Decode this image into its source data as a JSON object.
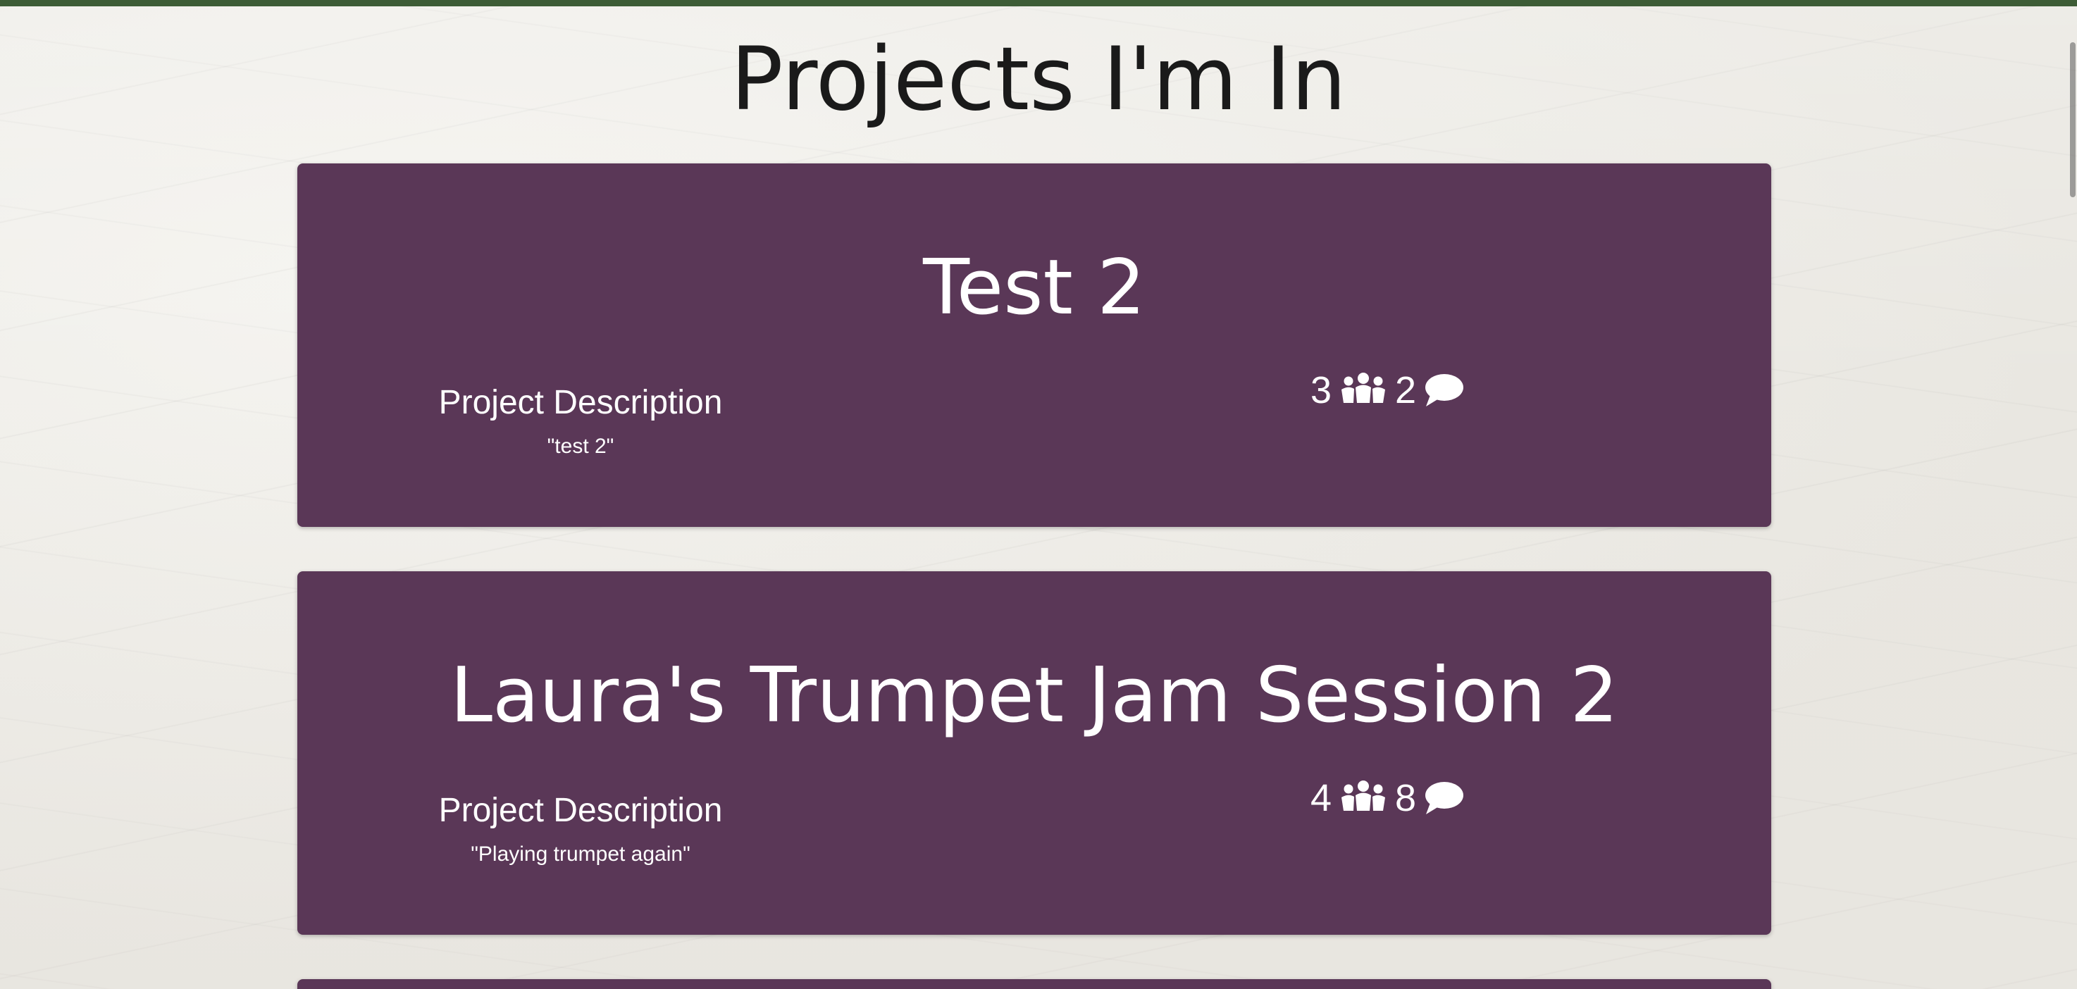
{
  "page": {
    "title": "Projects I'm In"
  },
  "projects": [
    {
      "title": "Test 2",
      "description_heading": "Project Description",
      "description": "\"test 2\"",
      "member_count": "3",
      "comment_count": "2",
      "members_icon": "people-group-icon",
      "comments_icon": "speech-bubble-icon"
    },
    {
      "title": "Laura's Trumpet Jam Session 2",
      "description_heading": "Project Description",
      "description": "\"Playing trumpet again\"",
      "member_count": "4",
      "comment_count": "8",
      "members_icon": "people-group-icon",
      "comments_icon": "speech-bubble-icon"
    }
  ],
  "colors": {
    "card_background": "#5a3757",
    "top_bar": "#3d5c36",
    "card_text": "#ffffff",
    "title_text": "#1a1a1a"
  }
}
